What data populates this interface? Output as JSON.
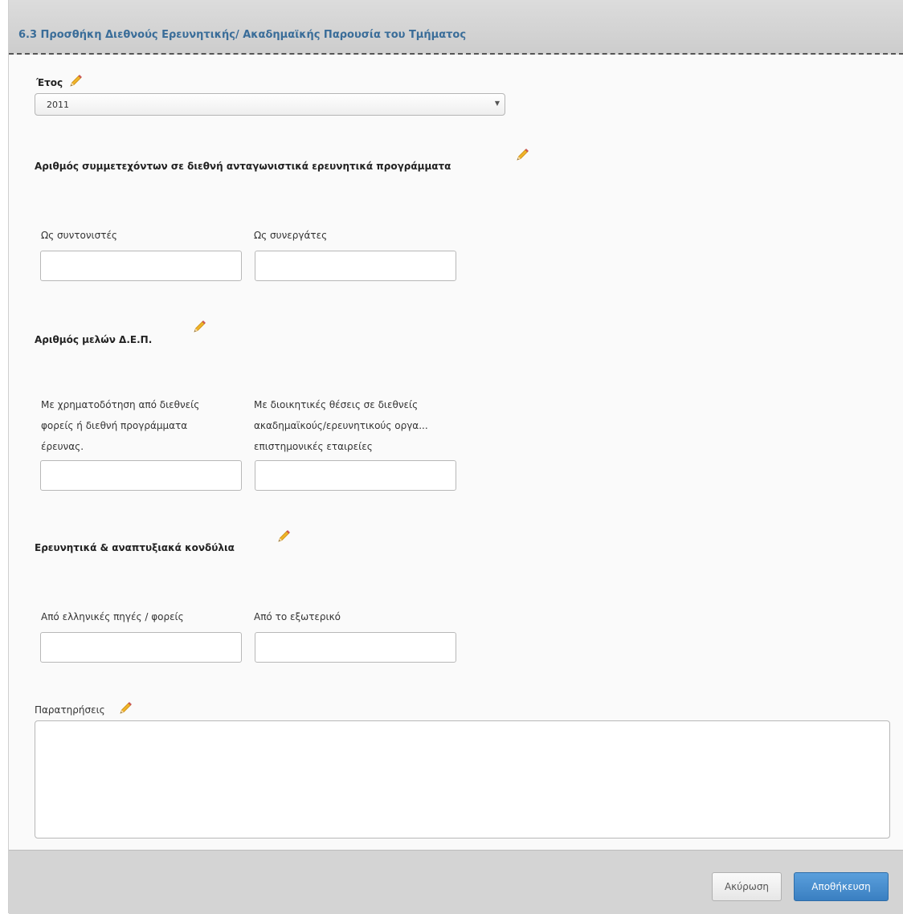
{
  "dialog": {
    "title": "6.3 Προσθήκη Διεθνούς Ερευνητικής/ Ακαδημαϊκής Παρουσία του Τμήματος"
  },
  "year": {
    "label": "Έτος",
    "selected": "2011"
  },
  "participants": {
    "heading": "Αριθμός συμμετεχόντων σε διεθνή ανταγωνιστικά ερευνητικά προγράμματα",
    "coordinators_label": "Ως συντονιστές",
    "collaborators_label": "Ως συνεργάτες"
  },
  "members": {
    "heading": "Αριθμός μελών Δ.Ε.Π.",
    "funding_label": "Με χρηματοδότηση από διεθνείς φορείς ή διεθνή προγράμματα έρευνας.",
    "admin_label": "Με διοικητικές θέσεις σε διεθνείς ακαδημαϊκούς/ερευνητικούς οργα... επιστημονικές εταιρείες"
  },
  "funds": {
    "heading": "Ερευνητικά & αναπτυξιακά κονδύλια",
    "greek_sources_label": "Από ελληνικές πηγές / φορείς",
    "abroad_label": "Από το εξωτερικό"
  },
  "notes": {
    "label": "Παρατηρήσεις"
  },
  "footer": {
    "cancel_label": "Ακύρωση",
    "save_label": "Αποθήκευση"
  },
  "colors": {
    "title": "#3a6d99",
    "primary_button": "#3a7fc1",
    "pencil": "#e8a317"
  }
}
